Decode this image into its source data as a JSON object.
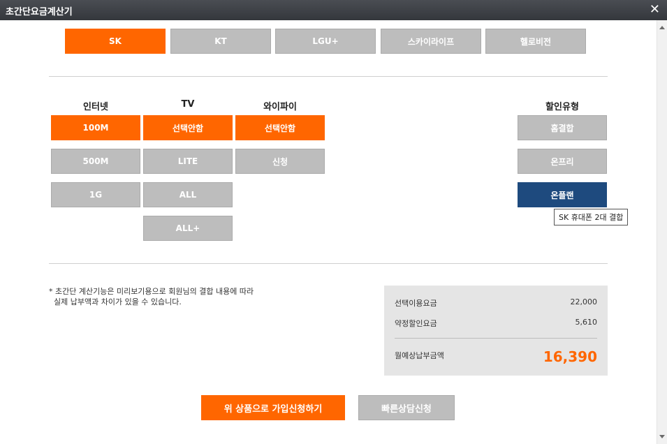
{
  "window": {
    "title": "초간단요금계산기"
  },
  "carriers": [
    "SK",
    "KT",
    "LGU+",
    "스카이라이프",
    "헬로비전"
  ],
  "columns": {
    "internet": {
      "header": "인터넷",
      "options": [
        "100M",
        "500M",
        "1G"
      ]
    },
    "tv": {
      "header": "TV",
      "options": [
        "선택안함",
        "LITE",
        "ALL",
        "ALL+"
      ]
    },
    "wifi": {
      "header": "와이파이",
      "options": [
        "선택안함",
        "신청"
      ]
    },
    "discount": {
      "header": "할인유형",
      "options": [
        "홈결합",
        "온프리",
        "온플랜"
      ]
    }
  },
  "tooltip": "SK 휴대폰 2대 결합",
  "note": {
    "line1": "* 초간단 계산기능은 미리보기용으로 회원님의 결합 내용에 따라",
    "line2": "실제 납부액과 차이가 있을 수 있습니다."
  },
  "summary": {
    "selected_label": "선택이용요금",
    "selected_value": "22,000",
    "discount_label": "약정할인요금",
    "discount_value": "5,610",
    "total_label": "월예상납부금액",
    "total_value": "16,390"
  },
  "actions": {
    "apply": "위 상품으로 가입신청하기",
    "consult": "빠른상담신청"
  },
  "colors": {
    "accent": "#ff6600",
    "selected_discount": "#1e4a7e",
    "unselected": "#bdbdbd"
  }
}
